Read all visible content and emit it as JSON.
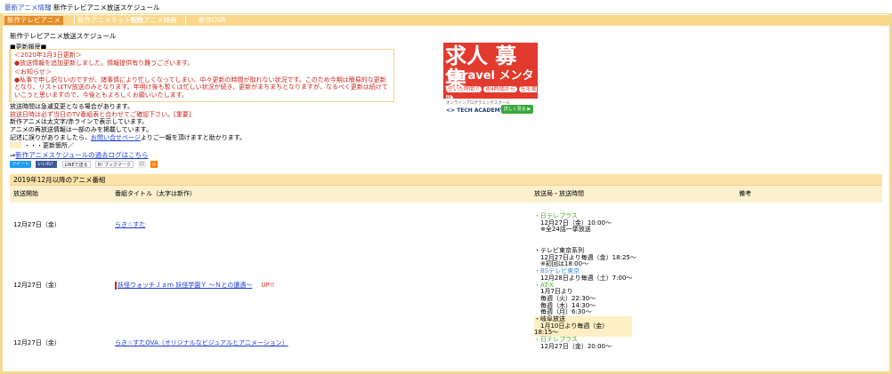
{
  "header": {
    "site_link": "最新アニメ情報",
    "separator": "：",
    "current_page": "新作テレビアニメ放送スケジュール"
  },
  "nav": {
    "tabs": [
      "新作テレビアニメ",
      "新作アニメネット配信",
      "新作アニメ映画",
      "新作OVA"
    ]
  },
  "page_title": "新作テレビアニメ放送スケジュール",
  "updates": {
    "heading": "■更新履歴■",
    "entry1_date": "＜2020年1月3日更新＞",
    "entry1_text": "●放送情報を追加更新しました。情報提供有り難うございます。",
    "notice_head": "＜お知らせ＞",
    "notice_text": "●私事で申し訳ないのですが、諸事情により忙しくなってしまい、中々更新の時間が取れない状況です。このため今期は簡易的な更新となり、リストはTV放送のみとなります。年明け後も暫くは忙しい状況が続き、更新がまちまちとなりますが、なるべく更新は続けていこうと思いますので、今後ともよろしくお願いいたします。"
  },
  "ad": {
    "headline": "求人 募集",
    "title": "Laravel メンター",
    "tag1": "空いた時間で",
    "tag2": "週4時間から",
    "tag3": "在宅業務",
    "school": "オンラインプログラミングスクール",
    "brand": "TECH ACADEMY",
    "cta": "詳しく見る ▶"
  },
  "info": {
    "line1": "放送時間は急遽変更となる場合があります。",
    "line2": "放送日時は必ず当日のTV番組表と合わせてご確認下さい。[重要]",
    "line3": "新作アニメは太文字/赤ラインで表示しています。",
    "line4": "アニメの再放送情報は一部のみを掲載しています。",
    "line5_prefix": "記述に誤りがありましたら、",
    "line5_link": "お問い合せページ",
    "line5_suffix": "よりご一報を頂けますと助かります。",
    "legend": "・・・更新箇所／"
  },
  "archive": {
    "arrow": "⇒",
    "link": "新作アニメスケジュールの過去ログはこちら"
  },
  "social": {
    "tweet": "ツイート",
    "fb": "いいね！",
    "line": "LINEで送る",
    "hatena": "B! ブックマーク"
  },
  "table": {
    "caption": "2019年12月以降のアニメ番組",
    "headers": {
      "start": "放送開始",
      "title": "番組タイトル（太字は新作）",
      "stations": "放送局・放送時間",
      "notes": "備考"
    },
    "rows": [
      {
        "date": "12月27日（金）",
        "title": "らき☆すた",
        "up": "",
        "lines": [
          {
            "t": "・日テレプラス",
            "c": "green"
          },
          {
            "t": "　12月27日（金）10:00〜",
            "c": ""
          },
          {
            "t": "　※全24話一挙放送",
            "c": ""
          }
        ]
      },
      {
        "date": "12月27日（金）",
        "title": "妖怪ウォッチＪａｍ 妖怪学園Ｙ 〜Ｎとの遭遇〜",
        "up": "UP!!",
        "lines": [
          {
            "t": "・テレビ東京系列",
            "c": ""
          },
          {
            "t": "　12月27日より毎週（金）18:25〜",
            "c": ""
          },
          {
            "t": "　※初回は18:00〜",
            "c": ""
          },
          {
            "t": "・BSテレビ東京",
            "c": "blue"
          },
          {
            "t": "　12月28日より毎週（土）7:00〜",
            "c": ""
          },
          {
            "t": "・AT-X",
            "c": "green"
          },
          {
            "t": "　1月7日より",
            "c": ""
          },
          {
            "t": "　毎週（火）22:30〜",
            "c": ""
          },
          {
            "t": "　毎週（木）14:30〜",
            "c": ""
          },
          {
            "t": "　毎週（月）6:30〜",
            "c": ""
          },
          {
            "t": "・岐阜放送",
            "c": "hl"
          },
          {
            "t": "　1月10日より毎週（金）18:15〜",
            "c": "hl"
          }
        ]
      },
      {
        "date": "12月27日（金）",
        "title": "らき☆すたOVA（オリジナルなビジュアルとアニメーション）",
        "up": "",
        "lines": [
          {
            "t": "・日テレプラス",
            "c": "green"
          },
          {
            "t": "　12月27日（金）20:00〜",
            "c": ""
          }
        ]
      }
    ]
  }
}
